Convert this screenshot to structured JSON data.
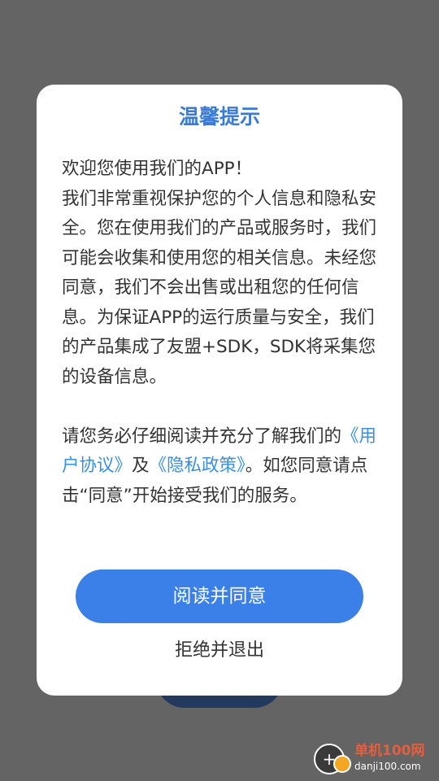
{
  "dialog": {
    "title": "温馨提示",
    "paragraph1_line1": "欢迎您使用我们的APP！",
    "paragraph1_body": "我们非常重视保护您的个人信息和隐私安全。您在使用我们的产品或服务时，我们可能会收集和使用您的相关信息。未经您同意，我们不会出售或出租您的任何信息。为保证APP的运行质量与安全，我们的产品集成了友盟+SDK，SDK将采集您的设备信息。",
    "paragraph2_prefix": "请您务必仔细阅读并充分了解我们的",
    "user_agreement_link": "《用户协议》",
    "and_text": "及",
    "privacy_policy_link": "《隐私政策》",
    "paragraph2_suffix": "。如您同意请点击“同意”开始接受我们的服务。",
    "agree_button": "阅读并同意",
    "reject_button": "拒绝并退出"
  },
  "watermark": {
    "name": "单机100网",
    "url": "danji100.com"
  },
  "colors": {
    "title": "#3a7bd5",
    "link": "#3a8ee6",
    "agree_button_bg": "#3b7fe8",
    "overlay": "#646464"
  }
}
